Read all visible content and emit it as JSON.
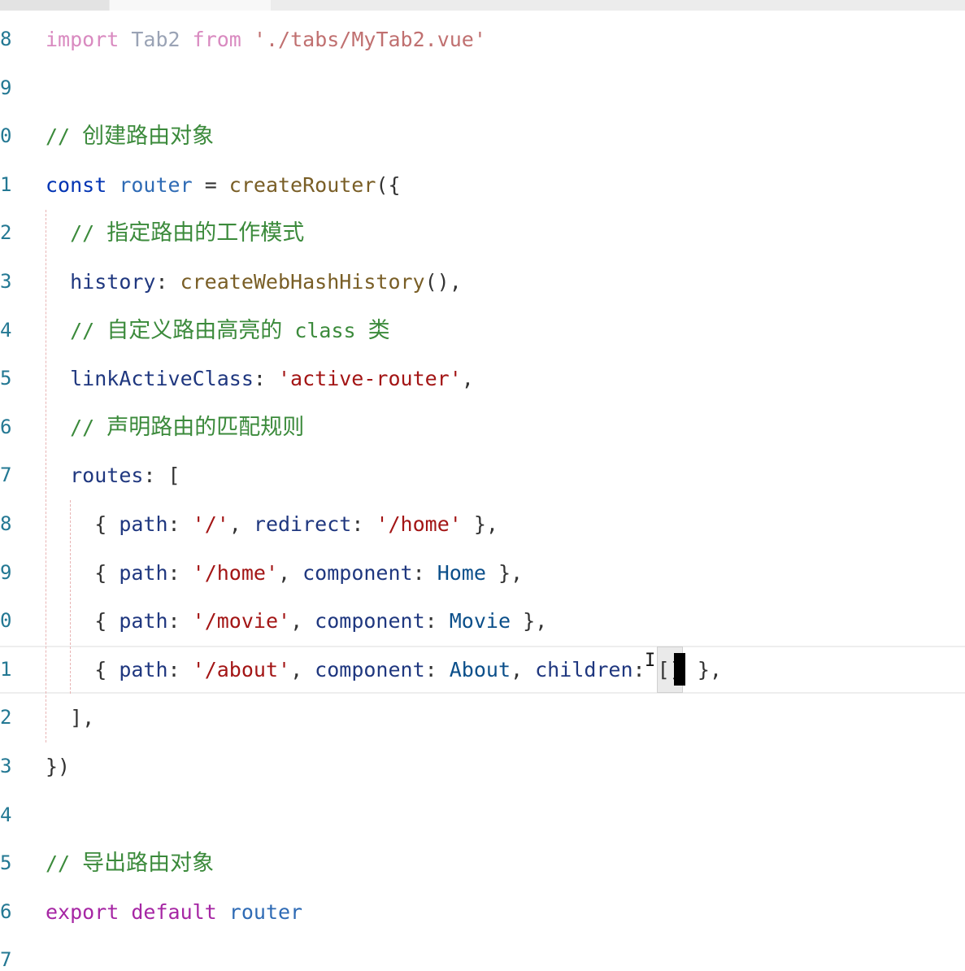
{
  "editor": {
    "lines": [
      {
        "num": "8",
        "tokens": [
          {
            "t": "import",
            "c": "kw-import"
          },
          {
            "t": " ",
            "c": "kw-plain"
          },
          {
            "t": "Tab2",
            "c": "kw-faded"
          },
          {
            "t": " ",
            "c": "kw-plain"
          },
          {
            "t": "from",
            "c": "kw-import"
          },
          {
            "t": " ",
            "c": "kw-plain"
          },
          {
            "t": "'./tabs/MyTab2.vue'",
            "c": "kw-str-light"
          }
        ]
      },
      {
        "num": "9",
        "tokens": []
      },
      {
        "num": "0",
        "tokens": [
          {
            "t": "// ",
            "c": "kw-comment"
          },
          {
            "t": "创建路由对象",
            "c": "kw-comment cjk"
          }
        ]
      },
      {
        "num": "1",
        "tokens": [
          {
            "t": "const",
            "c": "kw-const"
          },
          {
            "t": " ",
            "c": "kw-plain"
          },
          {
            "t": "router",
            "c": "kw-var"
          },
          {
            "t": " = ",
            "c": "kw-plain"
          },
          {
            "t": "createRouter",
            "c": "kw-fn"
          },
          {
            "t": "({",
            "c": "kw-plain"
          }
        ]
      },
      {
        "num": "2",
        "tokens": [
          {
            "t": "  // ",
            "c": "kw-comment"
          },
          {
            "t": "指定路由的工作模式",
            "c": "kw-comment cjk"
          }
        ]
      },
      {
        "num": "3",
        "tokens": [
          {
            "t": "  ",
            "c": "kw-plain"
          },
          {
            "t": "history",
            "c": "kw-prop"
          },
          {
            "t": ": ",
            "c": "kw-plain"
          },
          {
            "t": "createWebHashHistory",
            "c": "kw-fn"
          },
          {
            "t": "(),",
            "c": "kw-plain"
          }
        ]
      },
      {
        "num": "4",
        "tokens": [
          {
            "t": "  // ",
            "c": "kw-comment"
          },
          {
            "t": "自定义路由高亮的",
            "c": "kw-comment cjk"
          },
          {
            "t": " class ",
            "c": "kw-comment"
          },
          {
            "t": "类",
            "c": "kw-comment cjk"
          }
        ]
      },
      {
        "num": "5",
        "tokens": [
          {
            "t": "  ",
            "c": "kw-plain"
          },
          {
            "t": "linkActiveClass",
            "c": "kw-prop"
          },
          {
            "t": ": ",
            "c": "kw-plain"
          },
          {
            "t": "'active-router'",
            "c": "kw-str"
          },
          {
            "t": ",",
            "c": "kw-plain"
          }
        ]
      },
      {
        "num": "6",
        "tokens": [
          {
            "t": "  // ",
            "c": "kw-comment"
          },
          {
            "t": "声明路由的匹配规则",
            "c": "kw-comment cjk"
          }
        ]
      },
      {
        "num": "7",
        "tokens": [
          {
            "t": "  ",
            "c": "kw-plain"
          },
          {
            "t": "routes",
            "c": "kw-prop"
          },
          {
            "t": ": [",
            "c": "kw-plain"
          }
        ]
      },
      {
        "num": "8",
        "tokens": [
          {
            "t": "    { ",
            "c": "kw-plain"
          },
          {
            "t": "path",
            "c": "kw-prop"
          },
          {
            "t": ": ",
            "c": "kw-plain"
          },
          {
            "t": "'/'",
            "c": "kw-str"
          },
          {
            "t": ", ",
            "c": "kw-plain"
          },
          {
            "t": "redirect",
            "c": "kw-prop"
          },
          {
            "t": ": ",
            "c": "kw-plain"
          },
          {
            "t": "'/home'",
            "c": "kw-str"
          },
          {
            "t": " },",
            "c": "kw-plain"
          }
        ]
      },
      {
        "num": "9",
        "tokens": [
          {
            "t": "    { ",
            "c": "kw-plain"
          },
          {
            "t": "path",
            "c": "kw-prop"
          },
          {
            "t": ": ",
            "c": "kw-plain"
          },
          {
            "t": "'/home'",
            "c": "kw-str"
          },
          {
            "t": ", ",
            "c": "kw-plain"
          },
          {
            "t": "component",
            "c": "kw-prop"
          },
          {
            "t": ": ",
            "c": "kw-plain"
          },
          {
            "t": "Home",
            "c": "kw-ident"
          },
          {
            "t": " },",
            "c": "kw-plain"
          }
        ]
      },
      {
        "num": "0",
        "tokens": [
          {
            "t": "    { ",
            "c": "kw-plain"
          },
          {
            "t": "path",
            "c": "kw-prop"
          },
          {
            "t": ": ",
            "c": "kw-plain"
          },
          {
            "t": "'/movie'",
            "c": "kw-str"
          },
          {
            "t": ", ",
            "c": "kw-plain"
          },
          {
            "t": "component",
            "c": "kw-prop"
          },
          {
            "t": ": ",
            "c": "kw-plain"
          },
          {
            "t": "Movie",
            "c": "kw-ident"
          },
          {
            "t": " },",
            "c": "kw-plain"
          }
        ]
      },
      {
        "num": "1",
        "current": true,
        "tokens": [
          {
            "t": "    { ",
            "c": "kw-plain"
          },
          {
            "t": "path",
            "c": "kw-prop"
          },
          {
            "t": ": ",
            "c": "kw-plain"
          },
          {
            "t": "'/about'",
            "c": "kw-str"
          },
          {
            "t": ", ",
            "c": "kw-plain"
          },
          {
            "t": "component",
            "c": "kw-prop"
          },
          {
            "t": ": ",
            "c": "kw-plain"
          },
          {
            "t": "About",
            "c": "kw-ident"
          },
          {
            "t": ", ",
            "c": "kw-plain"
          },
          {
            "t": "children",
            "c": "kw-prop"
          },
          {
            "t": ": ",
            "c": "kw-plain"
          },
          {
            "t": "[]",
            "c": "kw-plain",
            "cursor": true
          },
          {
            "t": " },",
            "c": "kw-plain"
          }
        ]
      },
      {
        "num": "2",
        "tokens": [
          {
            "t": "  ],",
            "c": "kw-plain"
          }
        ]
      },
      {
        "num": "3",
        "tokens": [
          {
            "t": "})",
            "c": "kw-plain"
          }
        ]
      },
      {
        "num": "4",
        "tokens": []
      },
      {
        "num": "5",
        "tokens": [
          {
            "t": "// ",
            "c": "kw-comment"
          },
          {
            "t": "导出路由对象",
            "c": "kw-comment cjk"
          }
        ]
      },
      {
        "num": "6",
        "tokens": [
          {
            "t": "export",
            "c": "kw-keyword"
          },
          {
            "t": " ",
            "c": "kw-plain"
          },
          {
            "t": "default",
            "c": "kw-keyword"
          },
          {
            "t": " ",
            "c": "kw-plain"
          },
          {
            "t": "router",
            "c": "kw-var"
          }
        ]
      },
      {
        "num": "7",
        "tokens": []
      }
    ],
    "colors": {
      "background": "#ffffff",
      "line_number": "#237893",
      "comment": "#3b8a3b",
      "string": "#a31515",
      "keyword": "#a626a4",
      "property": "#1f377f"
    },
    "mouse_cursor_icon": "i-beam-cursor-icon"
  }
}
